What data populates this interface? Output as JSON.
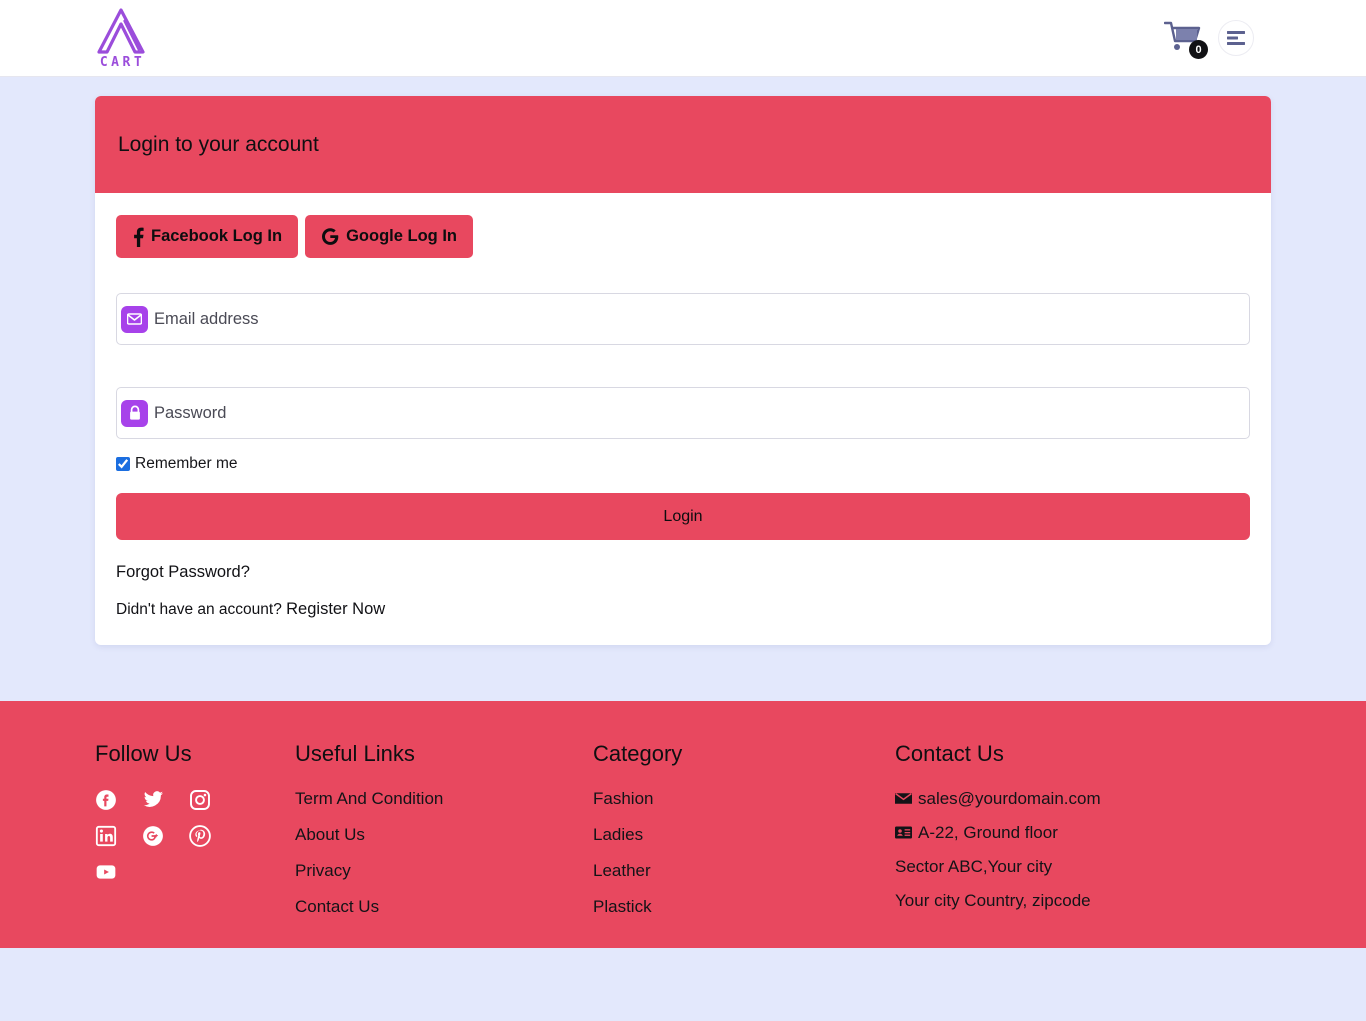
{
  "navbar": {
    "brand_word": "CART",
    "brand_icon": "a-logo-icon",
    "cart_icon": "shopping-cart-icon",
    "cart_count": "0",
    "menu_icon": "hamburger-menu-icon"
  },
  "login_card": {
    "header_title": "Login to your account",
    "facebook_button": "Facebook Log In",
    "facebook_icon": "facebook-f-icon",
    "google_button": "Google Log In",
    "google_icon": "google-g-icon",
    "email": {
      "placeholder": "Email address",
      "value": "",
      "icon": "envelope-icon"
    },
    "password": {
      "placeholder": "Password",
      "value": "",
      "icon": "lock-icon"
    },
    "remember_label": "Remember me",
    "remember_checked": true,
    "login_button": "Login",
    "forgot_link": "Forgot Password?",
    "register_prompt": "Didn't have an account?",
    "register_link": "Register Now"
  },
  "footer": {
    "follow_us": {
      "title": "Follow Us",
      "icons": [
        "facebook-icon",
        "twitter-icon",
        "instagram-icon",
        "linkedin-icon",
        "google-plus-icon",
        "pinterest-icon",
        "youtube-icon"
      ]
    },
    "useful_links": {
      "title": "Useful Links",
      "items": [
        "Term And Condition",
        "About Us",
        "Privacy",
        "Contact Us"
      ]
    },
    "category": {
      "title": "Category",
      "items": [
        "Fashion",
        "Ladies",
        "Leather",
        "Plastick"
      ]
    },
    "contact": {
      "title": "Contact Us",
      "email": "sales@yourdomain.com",
      "email_icon": "envelope-icon",
      "address_icon": "address-card-icon",
      "address_line1": "A-22, Ground floor",
      "address_line2": "Sector ABC,Your city",
      "address_line3": "Your city Country, zipcode"
    }
  },
  "colors": {
    "accent": "#e8485f",
    "brand_purple": "#a742ea",
    "page_bg": "#e3e8fc",
    "checkbox_blue": "#1b6ee0"
  }
}
